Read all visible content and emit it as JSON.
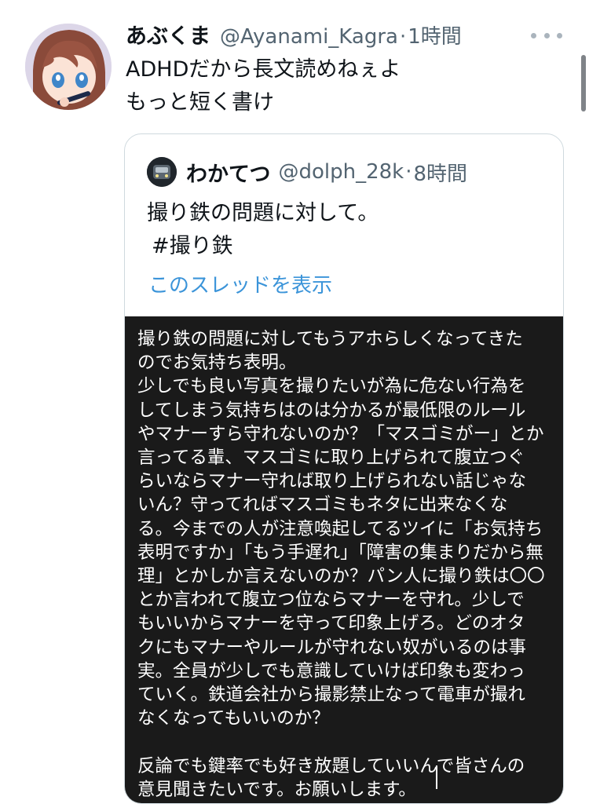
{
  "tweet": {
    "display_name": "あぶくま",
    "handle": "@Ayanami_Kagra",
    "separator": "·",
    "time": "1時間",
    "lines": [
      "ADHDだから長文読めねぇよ",
      "もっと短く書け"
    ],
    "avatar_icon": "anime-girl-avatar",
    "more_icon": "more-dots-icon"
  },
  "quoted": {
    "display_name": "わかてつ",
    "handle": "@dolph_28k",
    "separator": "·",
    "time": "8時間",
    "lines": [
      "撮り鉄の問題に対して。",
      "#撮り鉄"
    ],
    "show_thread": "このスレッドを表示",
    "avatar_icon": "train-avatar",
    "image_text": "撮り鉄の問題に対してもうアホらしくなってきた\nのでお気持ち表明。\n少しでも良い写真を撮りたいが為に危ない行為を\nしてしまう気持ちはのは分かるが最低限のルール\nやマナーすら守れないのか？「マスゴミがー」とか\n言ってる輩、マスゴミに取り上げられて腹立つぐ\nらいならマナー守れば取り上げられない話じゃな\nいん？守ってればマスゴミもネタに出来なくな\nる。今までの人が注意喚起してるツイに「お気持ち\n表明ですか」「もう手遅れ」「障害の集まりだから無\n理」とかしか言えないのか？パン人に撮り鉄は〇〇\nとか言われて腹立つ位ならマナーを守れ。少しで\nもいいからマナーを守って印象上げろ。どのオタ\nクにもマナーやルールが守れない奴がいるのは事\n実。全員が少しでも意識していけば印象も変わっ\nていく。鉄道会社から撮影禁止なって電車が撮れ\nなくなってもいいのか？\n\n反論でも鍵率でも好き放題していいんで皆さんの\n意見聞きたいです。お願いします。"
  },
  "colors": {
    "text": "#0f1419",
    "secondary": "#536471",
    "link": "#3b94d9",
    "image_bg": "#1a1a1a",
    "border": "#cfd9de"
  }
}
